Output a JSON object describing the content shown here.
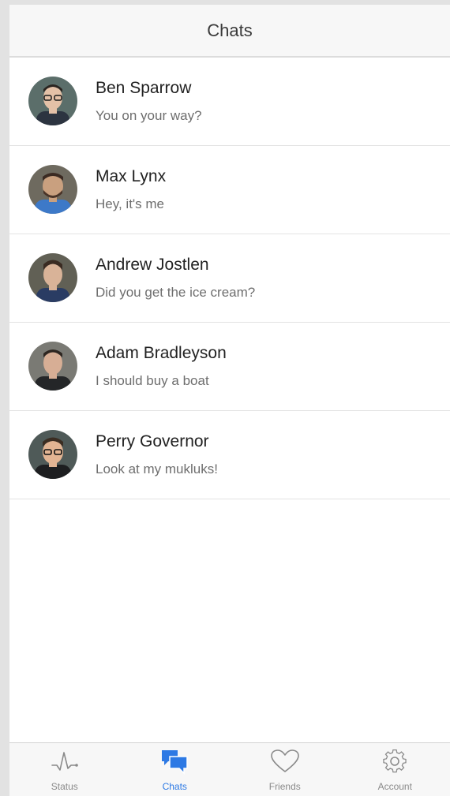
{
  "header": {
    "title": "Chats"
  },
  "chats": [
    {
      "name": "Ben Sparrow",
      "message": "You on your way?",
      "avatar_bg": "#5b6e6a",
      "avatar_face": "#e4c1a7",
      "avatar_shirt": "#2c3440"
    },
    {
      "name": "Max Lynx",
      "message": "Hey, it's me",
      "avatar_bg": "#6e6a5f",
      "avatar_face": "#c9a07f",
      "avatar_shirt": "#3d79c8"
    },
    {
      "name": "Andrew Jostlen",
      "message": "Did you get the ice cream?",
      "avatar_bg": "#616055",
      "avatar_face": "#d9b398",
      "avatar_shirt": "#2a3c63"
    },
    {
      "name": "Adam Bradleyson",
      "message": "I should buy a boat",
      "avatar_bg": "#7a7a74",
      "avatar_face": "#d7ae95",
      "avatar_shirt": "#242628"
    },
    {
      "name": "Perry Governor",
      "message": "Look at my mukluks!",
      "avatar_bg": "#4f5a58",
      "avatar_face": "#e2b493",
      "avatar_shirt": "#1d1e20"
    }
  ],
  "tabbar": {
    "active_color": "#2d79e4",
    "inactive_color": "#8a8a8a",
    "tabs": [
      {
        "label": "Status",
        "icon": "pulse-icon"
      },
      {
        "label": "Chats",
        "icon": "chat-bubbles-icon",
        "active": true
      },
      {
        "label": "Friends",
        "icon": "heart-icon"
      },
      {
        "label": "Account",
        "icon": "gear-icon"
      }
    ]
  }
}
